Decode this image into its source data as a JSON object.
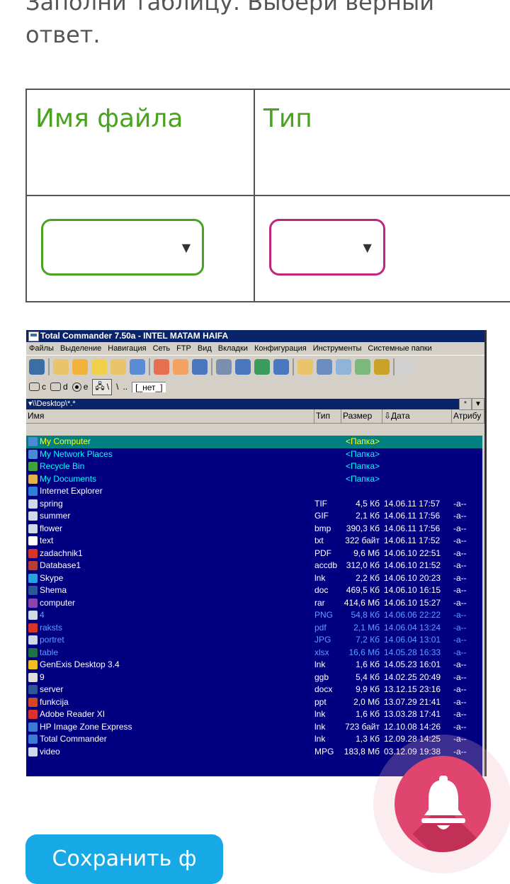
{
  "question": {
    "text": "Заполни таблицу. Выбери верный ответ."
  },
  "table": {
    "col1_header": "Имя файла",
    "col2_header": "Тип"
  },
  "tc": {
    "title": "Total Commander 7.50a - INTEL MATAM HAIFA",
    "menu": [
      "Файлы",
      "Выделение",
      "Навигация",
      "Сеть",
      "FTP",
      "Вид",
      "Вкладки",
      "Конфигурация",
      "Инструменты",
      "Системные папки"
    ],
    "drives": {
      "c": "c",
      "d": "d",
      "e": "e",
      "net": "\\",
      "backslash": "\\",
      "dots": "..",
      "label": "[_нет_]"
    },
    "path": "\\\\Desktop\\*.*",
    "path_star": "*",
    "path_down": "▼",
    "headers": {
      "name": "Имя",
      "type": "Тип",
      "size": "Размер",
      "date": "⇩Дата",
      "attr": "Атрибу"
    },
    "files": [
      {
        "name": "My Computer",
        "type": "",
        "size": "<Папка>",
        "date": "",
        "attr": "",
        "icon_color": "#4a8ad4"
      },
      {
        "name": "My Network Places",
        "type": "",
        "size": "<Папка>",
        "date": "",
        "attr": "",
        "icon_color": "#4a8ad4"
      },
      {
        "name": "Recycle Bin",
        "type": "",
        "size": "<Папка>",
        "date": "",
        "attr": "",
        "icon_color": "#3fa33f"
      },
      {
        "name": "My Documents",
        "type": "",
        "size": "<Папка>",
        "date": "",
        "attr": "",
        "icon_color": "#e2b34a"
      },
      {
        "name": "Internet Explorer",
        "type": "",
        "size": "",
        "date": "",
        "attr": "",
        "icon_color": "#2f7fd8"
      },
      {
        "name": "spring",
        "type": "TIF",
        "size": "4,5 Кб",
        "date": "14.06.11 17:57",
        "attr": "-a--",
        "icon_color": "#cfd8e8"
      },
      {
        "name": "summer",
        "type": "GIF",
        "size": "2,1 Кб",
        "date": "14.06.11 17:56",
        "attr": "-a--",
        "icon_color": "#cfd8e8"
      },
      {
        "name": "flower",
        "type": "bmp",
        "size": "390,3 Кб",
        "date": "14.06.11 17:56",
        "attr": "-a--",
        "icon_color": "#cfd8e8"
      },
      {
        "name": "text",
        "type": "txt",
        "size": "322 байт",
        "date": "14.06.11 17:52",
        "attr": "-a--",
        "icon_color": "#ffffff"
      },
      {
        "name": "zadachnik1",
        "type": "PDF",
        "size": "9,6 Мб",
        "date": "14.06.10 22:51",
        "attr": "-a--",
        "icon_color": "#d9342b"
      },
      {
        "name": "Database1",
        "type": "accdb",
        "size": "312,0 Кб",
        "date": "14.06.10 21:52",
        "attr": "-a--",
        "icon_color": "#b73c3c"
      },
      {
        "name": "Skype",
        "type": "lnk",
        "size": "2,2 Кб",
        "date": "14.06.10 20:23",
        "attr": "-a--",
        "icon_color": "#2aa0e0"
      },
      {
        "name": "Shema",
        "type": "doc",
        "size": "469,5 Кб",
        "date": "14.06.10 16:15",
        "attr": "-a--",
        "icon_color": "#2b5797"
      },
      {
        "name": "computer",
        "type": "rar",
        "size": "414,6 Мб",
        "date": "14.06.10 15:27",
        "attr": "-a--",
        "icon_color": "#8e44ad"
      },
      {
        "name": "4",
        "type": "PNG",
        "size": "54,8 Кб",
        "date": "14.06.06 22:22",
        "attr": "-a--",
        "icon_color": "#cfd8e8",
        "marked": true
      },
      {
        "name": "raksts",
        "type": "pdf",
        "size": "2,1 Мб",
        "date": "14.06.04 13:24",
        "attr": "-a--",
        "icon_color": "#d9342b",
        "marked": true
      },
      {
        "name": "portret",
        "type": "JPG",
        "size": "7,2 Кб",
        "date": "14.06.04 13:01",
        "attr": "-a--",
        "icon_color": "#cfd8e8",
        "marked": true
      },
      {
        "name": "table",
        "type": "xlsx",
        "size": "16,6 Мб",
        "date": "14.05.28 16:33",
        "attr": "-a--",
        "icon_color": "#1e7145",
        "marked": true
      },
      {
        "name": "GenExis Desktop 3.4",
        "type": "lnk",
        "size": "1,6 Кб",
        "date": "14.05.23 16:01",
        "attr": "-a--",
        "icon_color": "#f0c020"
      },
      {
        "name": "9",
        "type": "ggb",
        "size": "5,4 Кб",
        "date": "14.02.25 20:49",
        "attr": "-a--",
        "icon_color": "#dddddd"
      },
      {
        "name": "server",
        "type": "docx",
        "size": "9,9 Кб",
        "date": "13.12.15 23:16",
        "attr": "-a--",
        "icon_color": "#2b5797"
      },
      {
        "name": "funkcija",
        "type": "ppt",
        "size": "2,0 Мб",
        "date": "13.07.29 21:41",
        "attr": "-a--",
        "icon_color": "#d24726"
      },
      {
        "name": "Adobe Reader XI",
        "type": "lnk",
        "size": "1,6 Кб",
        "date": "13.03.28 17:41",
        "attr": "-a--",
        "icon_color": "#d9342b"
      },
      {
        "name": "HP Image Zone Express",
        "type": "lnk",
        "size": "723 байт",
        "date": "12.10.08 14:26",
        "attr": "-a--",
        "icon_color": "#3a7bd5"
      },
      {
        "name": "Total Commander",
        "type": "lnk",
        "size": "1,3 Кб",
        "date": "12.09.28 14:25",
        "attr": "-a--",
        "icon_color": "#3a7bd5"
      },
      {
        "name": "video",
        "type": "MPG",
        "size": "183,8 Мб",
        "date": "03.12.09 19:38",
        "attr": "-a--",
        "icon_color": "#cfd8e8"
      }
    ],
    "toolbar_colors": [
      "#3a6ea5",
      "#e9c46a",
      "#f2b33d",
      "#f2d04a",
      "#e9c46a",
      "#5b8dd6",
      "#e76f51",
      "#f4a261",
      "#4a78c0",
      "#7a8fb0",
      "#4a78c0",
      "#3a9d5d",
      "#4a78c0",
      "#e9c46a",
      "#6a8cc0",
      "#8fb3d9",
      "#7cb87c",
      "#c9a227",
      "#d0d0d0"
    ]
  },
  "button": {
    "label": "Сохранить ф"
  },
  "colors": {
    "green": "#4aa31f",
    "magenta": "#c0267e",
    "bell": "#e0456f",
    "button": "#17a8e6"
  }
}
